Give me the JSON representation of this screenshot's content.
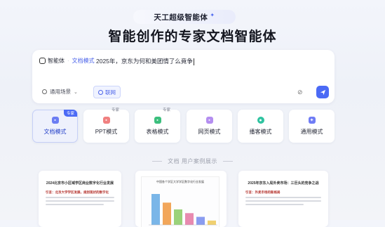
{
  "header": {
    "badge": "天工超级智能体",
    "title": "智能创作的专家文档智能体"
  },
  "input": {
    "agent_label": "智能体",
    "mode_label": "文档模式",
    "query": "2025年，京东为何和美团情了么竟争",
    "scene_label": "通用场景",
    "web_label": "联网"
  },
  "tools": [
    {
      "label": "文档模式",
      "badge": "专家",
      "active": true,
      "color": "#6b7df3"
    },
    {
      "label": "PPT模式",
      "badge": "专家",
      "active": false,
      "color": "#f08080"
    },
    {
      "label": "表格模式",
      "badge": "专家",
      "active": false,
      "color": "#3cbf7d"
    },
    {
      "label": "网页模式",
      "badge": "",
      "active": false,
      "color": "#b48ef0"
    },
    {
      "label": "播客模式",
      "badge": "",
      "active": false,
      "color": "#2fc3a0"
    },
    {
      "label": "通用模式",
      "badge": "",
      "active": false,
      "color": "#6f7cf5"
    }
  ],
  "cases": {
    "title": "文档 用户案例展示",
    "doc1_title": "2024北京市小区域学区商业数字化行业发展",
    "doc1_sub": "引言：北京大学学区发展，规划现状的数字化",
    "doc3_title": "2025年京东入局外卖市场：三巨头的竞争之战",
    "doc3_sub": "引言：外卖市场的新格局",
    "chart_title": "中国各个学区大学学区数字化行业发展"
  },
  "chart_data": {
    "type": "bar",
    "title": "中国各个学区大学学区数字化行业发展",
    "categories": [
      "1",
      "2",
      "3",
      "4",
      "5",
      "6"
    ],
    "values": [
      100,
      72,
      50,
      38,
      26,
      14
    ]
  }
}
